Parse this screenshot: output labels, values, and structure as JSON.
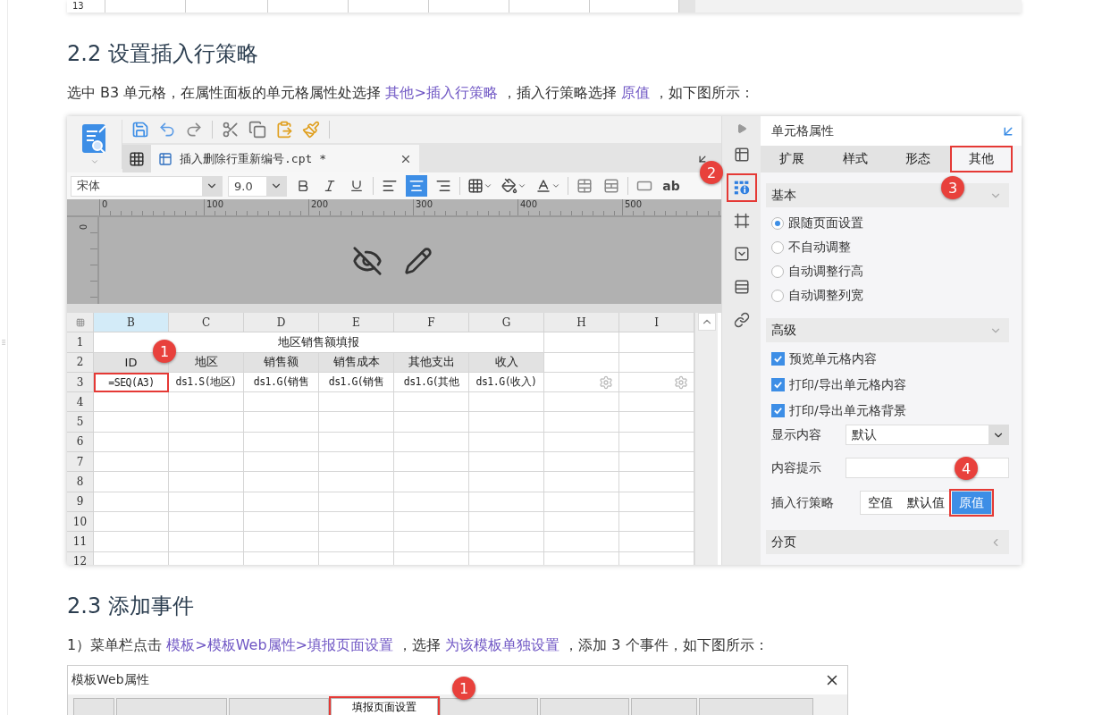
{
  "top_table": {
    "row_number": "13"
  },
  "section_2_2": {
    "heading": "2.2 设置插入行策略",
    "paragraph": [
      {
        "kind": "text",
        "text": "选中 B3 单元格，在属性面板的单元格属性处选择 "
      },
      {
        "kind": "link",
        "text": "其他>插入行策略"
      },
      {
        "kind": "text",
        "text": " ，插入行策略选择 "
      },
      {
        "kind": "link",
        "text": "原值"
      },
      {
        "kind": "text",
        "text": " ，如下图所示："
      }
    ]
  },
  "designer": {
    "file_tab": {
      "title": "插入删除行重新编号.cpt *"
    },
    "format_toolbar": {
      "font": "宋体",
      "size": "9.0",
      "align": [
        {
          "kind": "left",
          "selected": false
        },
        {
          "kind": "center",
          "selected": true
        },
        {
          "kind": "right",
          "selected": false
        }
      ],
      "text_button": "ab"
    },
    "ruler": {
      "ticks": [
        "0",
        "100",
        "200",
        "300",
        "400",
        "500"
      ],
      "vertical_tick": "0"
    },
    "sheet": {
      "columns": [
        {
          "label": "B",
          "selected": true
        },
        {
          "label": "C",
          "selected": false
        },
        {
          "label": "D",
          "selected": false
        },
        {
          "label": "E",
          "selected": false
        },
        {
          "label": "F",
          "selected": false
        },
        {
          "label": "G",
          "selected": false
        },
        {
          "label": "H",
          "selected": false
        },
        {
          "label": "I",
          "selected": false
        }
      ],
      "rows": [
        {
          "number": "1",
          "kind": "title",
          "title": "地区销售额填报"
        },
        {
          "number": "2",
          "kind": "header",
          "cells": [
            "ID",
            "地区",
            "销售额",
            "销售成本",
            "其他支出",
            "收入"
          ]
        },
        {
          "number": "3",
          "kind": "data",
          "cells": [
            {
              "kind": "text",
              "text": "=SEQ(A3)",
              "selected": true,
              "highlighted": true
            },
            {
              "kind": "text",
              "text": "ds1.S(地区)",
              "selected": false,
              "highlighted": false
            },
            {
              "kind": "text",
              "text": "ds1.G(销售",
              "selected": false,
              "highlighted": false
            },
            {
              "kind": "text",
              "text": "ds1.G(销售",
              "selected": false,
              "highlighted": false
            },
            {
              "kind": "text",
              "text": "ds1.G(其他",
              "selected": false,
              "highlighted": false
            },
            {
              "kind": "text",
              "text": "ds1.G(收入)",
              "selected": false,
              "highlighted": false
            },
            {
              "kind": "gear"
            },
            {
              "kind": "gear"
            }
          ]
        },
        {
          "number": "4",
          "kind": "empty"
        },
        {
          "number": "5",
          "kind": "empty"
        },
        {
          "number": "6",
          "kind": "empty"
        },
        {
          "number": "7",
          "kind": "empty"
        },
        {
          "number": "8",
          "kind": "empty"
        },
        {
          "number": "9",
          "kind": "empty"
        },
        {
          "number": "10",
          "kind": "empty"
        },
        {
          "number": "11",
          "kind": "empty"
        },
        {
          "number": "12",
          "kind": "empty"
        }
      ],
      "callout": "1"
    }
  },
  "side_strip": {
    "items": [
      {
        "kind": "layout",
        "selected": false,
        "highlighted": false
      },
      {
        "kind": "cell",
        "selected": true,
        "highlighted": true
      },
      {
        "kind": "border",
        "selected": false,
        "highlighted": false
      },
      {
        "kind": "widget",
        "selected": false,
        "highlighted": false
      },
      {
        "kind": "condition",
        "selected": false,
        "highlighted": false
      },
      {
        "kind": "link",
        "selected": false,
        "highlighted": false
      }
    ],
    "callout": "2"
  },
  "panel": {
    "title": "单元格属性",
    "tabs": [
      {
        "label": "扩展",
        "selected": false,
        "highlighted": false
      },
      {
        "label": "样式",
        "selected": false,
        "highlighted": false
      },
      {
        "label": "形态",
        "selected": false,
        "highlighted": false
      },
      {
        "label": "其他",
        "selected": true,
        "highlighted": true
      }
    ],
    "tabs_callout": "3",
    "basic": {
      "title": "基本",
      "expanded": true,
      "options": [
        {
          "label": "跟随页面设置",
          "selected": true
        },
        {
          "label": "不自动调整",
          "selected": false
        },
        {
          "label": "自动调整行高",
          "selected": false
        },
        {
          "label": "自动调整列宽",
          "selected": false
        }
      ]
    },
    "advanced": {
      "title": "高级",
      "expanded": true,
      "checks": [
        {
          "label": "预览单元格内容",
          "checked": true
        },
        {
          "label": "打印/导出单元格内容",
          "checked": true
        },
        {
          "label": "打印/导出单元格背景",
          "checked": true
        }
      ],
      "display": {
        "label": "显示内容",
        "value": "默认"
      },
      "tooltip": {
        "label": "内容提示"
      },
      "callout": "4",
      "strategy": {
        "label": "插入行策略",
        "options": [
          {
            "label": "空值",
            "selected": false,
            "highlighted": false
          },
          {
            "label": "默认值",
            "selected": false,
            "highlighted": false
          },
          {
            "label": "原值",
            "selected": true,
            "highlighted": true
          }
        ]
      }
    },
    "paging": {
      "title": "分页",
      "expanded": false
    }
  },
  "section_2_3": {
    "heading": "2.3 添加事件",
    "paragraph": [
      {
        "kind": "text",
        "text": "1）菜单栏点击 "
      },
      {
        "kind": "link",
        "text": "模板>模板Web属性>填报页面设置"
      },
      {
        "kind": "text",
        "text": " ，选择 "
      },
      {
        "kind": "link",
        "text": "为该模板单独设置"
      },
      {
        "kind": "text",
        "text": " ，添加 3 个事件，如下图所示："
      }
    ]
  },
  "dialog": {
    "title": "模板Web属性",
    "tabs": [
      {
        "selected": false,
        "highlighted": false
      },
      {
        "selected": false,
        "highlighted": false
      },
      {
        "selected": false,
        "highlighted": false
      },
      {
        "label": "填报页面设置",
        "selected": true,
        "highlighted": true
      },
      {
        "selected": false,
        "highlighted": false
      },
      {
        "selected": false,
        "highlighted": false
      },
      {
        "selected": false,
        "highlighted": false
      },
      {
        "selected": false,
        "highlighted": false
      }
    ],
    "callout": "1"
  }
}
